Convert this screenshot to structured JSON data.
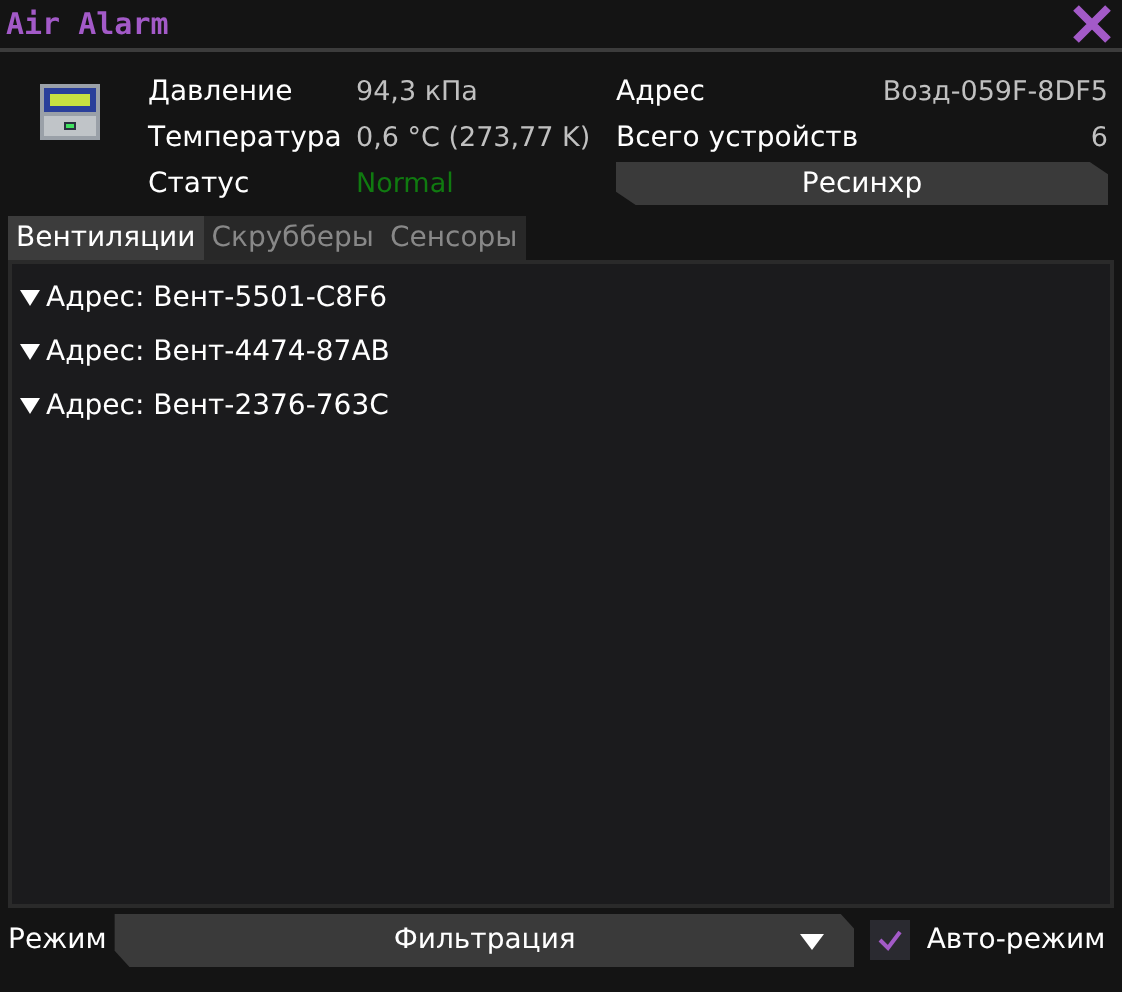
{
  "window": {
    "title": "Air Alarm"
  },
  "info": {
    "pressure_label": "Давление",
    "pressure": "94,3 кПа",
    "temperature_label": "Температура",
    "temperature": "0,6 °C (273,77 K)",
    "status_label": "Статус",
    "status": {
      "text": "Normal",
      "kind": "normal"
    },
    "address_label": "Адрес",
    "address": "Возд-059F-8DF5",
    "devices_label": "Всего устройств",
    "devices": "6"
  },
  "resync_button": "Ресинхр",
  "tabs": [
    {
      "label": "Вентиляции",
      "selected": true
    },
    {
      "label": "Скрубберы",
      "selected": false
    },
    {
      "label": "Сенсоры",
      "selected": false
    }
  ],
  "devices": [
    {
      "label": "Адрес: Вент-5501-C8F6",
      "expanded": false
    },
    {
      "label": "Адрес: Вент-4474-87AB",
      "expanded": false
    },
    {
      "label": "Адрес: Вент-2376-763C",
      "expanded": false
    }
  ],
  "footer": {
    "mode_label": "Режим",
    "mode": "Фильтрация",
    "auto_checked": true,
    "auto_label": "Авто-режим"
  }
}
